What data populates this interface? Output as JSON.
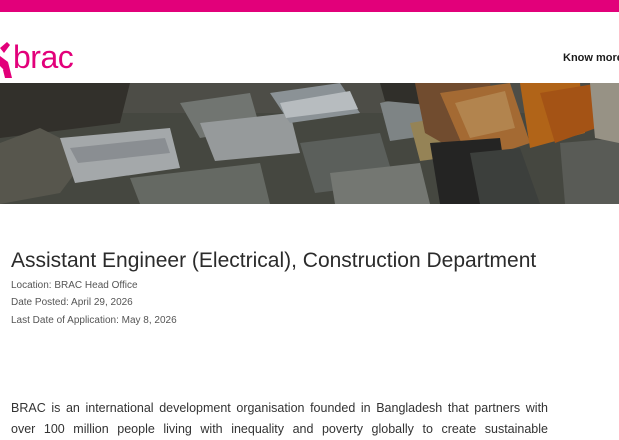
{
  "brand": {
    "name": "brac",
    "accent": "#e2007a",
    "logo_icon": "brac-logo-icon"
  },
  "header": {
    "nav_link": "Know more"
  },
  "hero": {
    "image": "slum-rooftops-photo"
  },
  "job": {
    "title": "Assistant Engineer (Electrical), Construction Department",
    "location": "Location: BRAC Head Office",
    "date_posted": "Date Posted: April 29, 2026",
    "last_date": "Last Date of Application: May 8, 2026"
  },
  "description": {
    "paragraph": "BRAC is an international development organisation founded in Bangladesh that partners with over 100 million people living with inequality and poverty globally to create sustainable"
  }
}
